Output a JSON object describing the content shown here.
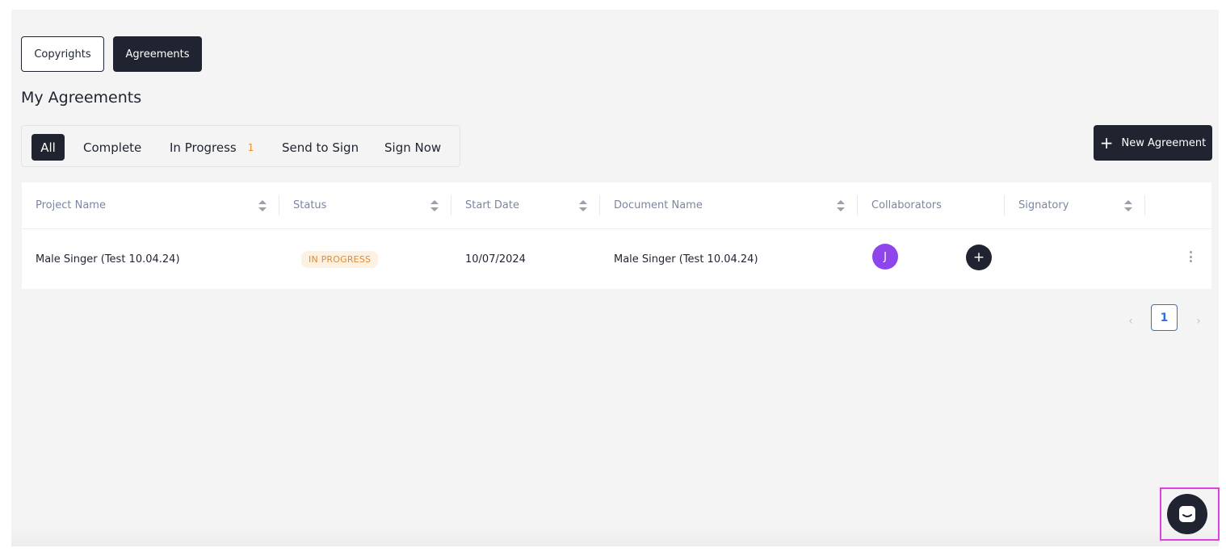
{
  "tabs": {
    "copyrights": "Copyrights",
    "agreements": "Agreements"
  },
  "page_title": "My Agreements",
  "filters": [
    {
      "label": "All",
      "active": true
    },
    {
      "label": "Complete"
    },
    {
      "label": "In Progress",
      "count": "1"
    },
    {
      "label": "Send to Sign"
    },
    {
      "label": "Sign Now"
    }
  ],
  "new_agreement_label": "New Agreement",
  "table": {
    "columns": [
      "Project Name",
      "Status",
      "Start Date",
      "Document Name",
      "Collaborators",
      "Signatory"
    ],
    "rows": [
      {
        "project_name": "Male Singer (Test 10.04.24)",
        "status": "IN PROGRESS",
        "start_date": "10/07/2024",
        "document_name": "Male Singer (Test 10.04.24)",
        "collaborator_initial": "J"
      }
    ]
  },
  "pagination": {
    "current_page": "1"
  },
  "icons": {
    "add": "plus-icon",
    "sort": "sort-icon",
    "menu": "kebab-menu-icon",
    "prev": "chevron-left-icon",
    "next": "chevron-right-icon",
    "chat": "chat-icon"
  },
  "colors": {
    "primary": "#1f2430",
    "status_in_progress": "#e58a2a",
    "avatar": "#8f45ec",
    "pagination_active": "#2f6fe0",
    "highlight": "#e040e0"
  }
}
